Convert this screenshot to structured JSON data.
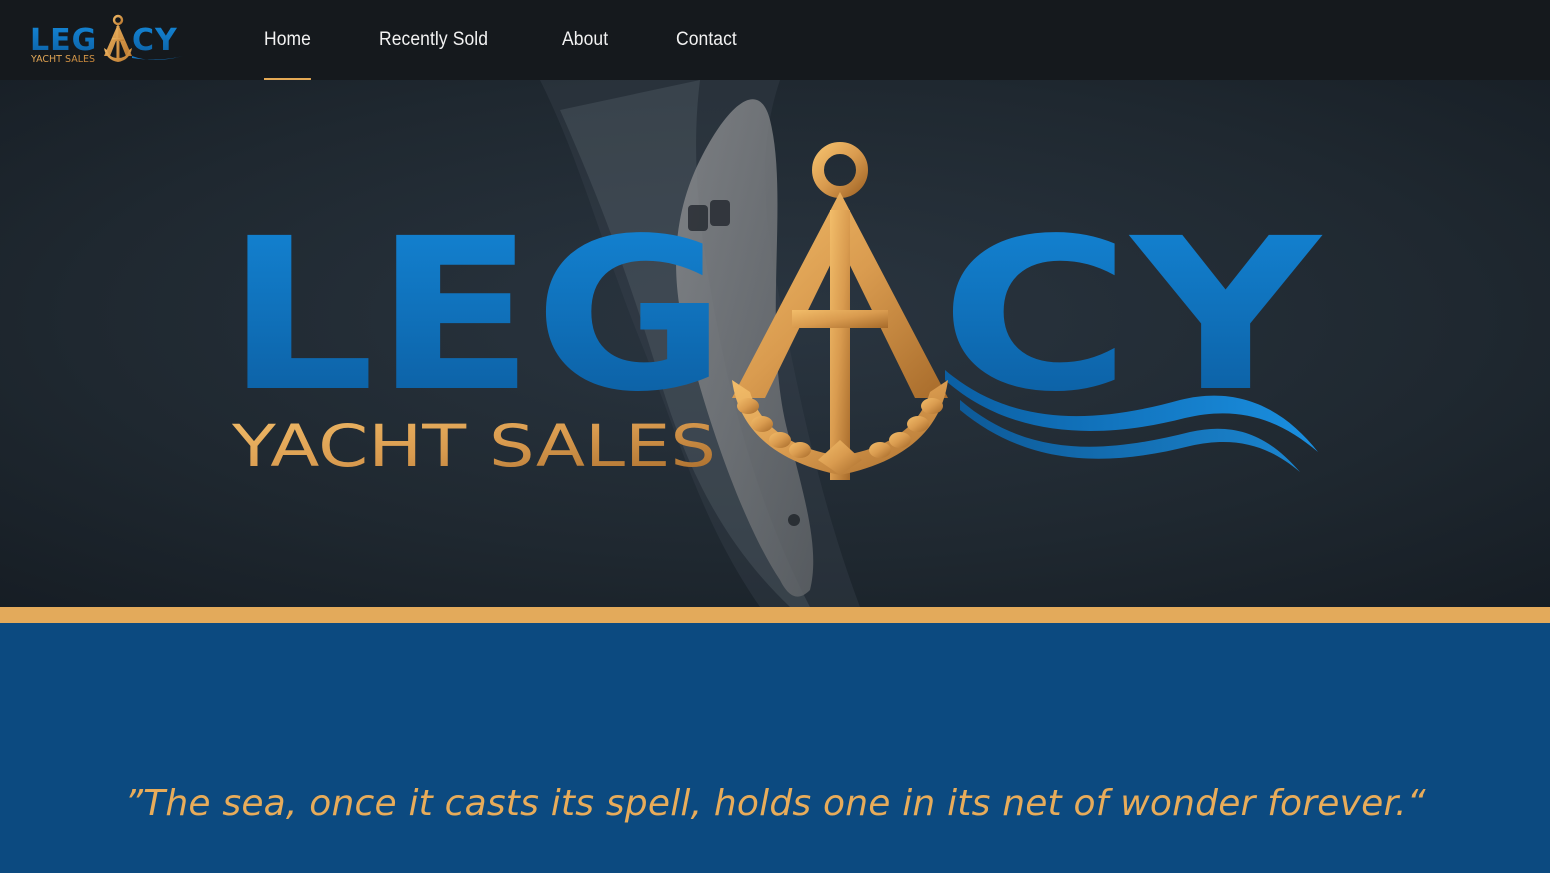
{
  "header": {
    "logo": {
      "word_left": "LEG",
      "word_right": "CY",
      "tagline": "YACHT SALES"
    },
    "nav": [
      {
        "label": "Home",
        "active": true
      },
      {
        "label": "Recently Sold",
        "active": false
      },
      {
        "label": "About",
        "active": false
      },
      {
        "label": "Contact",
        "active": false
      }
    ]
  },
  "hero": {
    "logo": {
      "word_left": "LEG",
      "word_right": "CY",
      "tagline": "YACHT SALES"
    },
    "icon": "anchor-icon"
  },
  "quote": {
    "text": "”The sea, once it casts its spell, holds one in its net of wonder forever.“"
  },
  "colors": {
    "brand_blue": "#0b68b0",
    "brand_gold": "#e3aa5b",
    "header_bg": "#15191d",
    "band_bg": "#0c4a80"
  }
}
